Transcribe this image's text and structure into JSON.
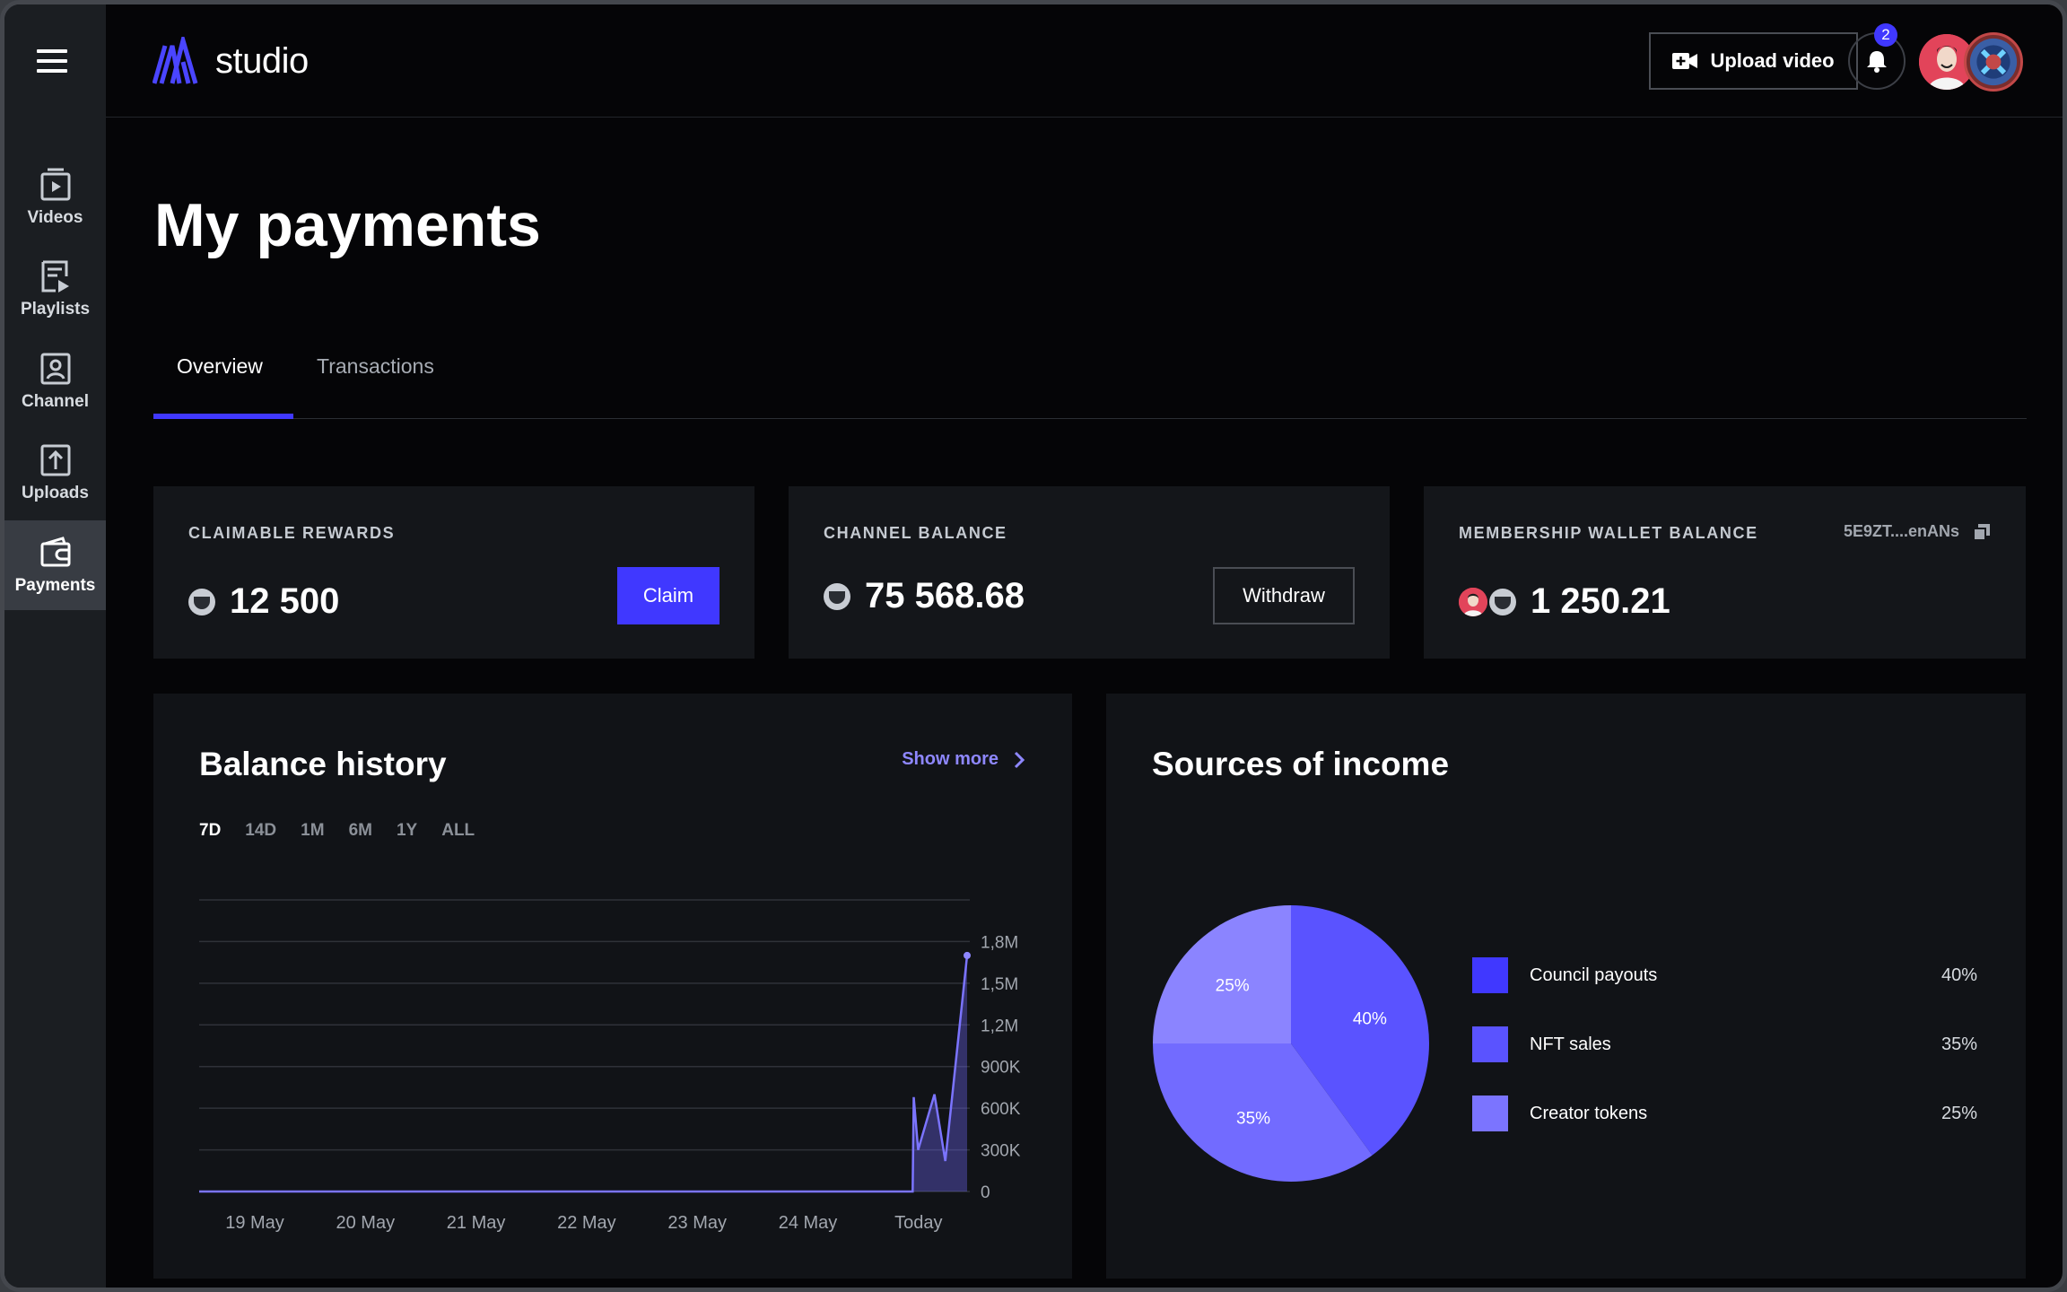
{
  "app": {
    "brand": "studio"
  },
  "sidebar": {
    "items": [
      {
        "label": "Videos",
        "icon": "video-icon"
      },
      {
        "label": "Playlists",
        "icon": "playlist-icon"
      },
      {
        "label": "Channel",
        "icon": "channel-icon"
      },
      {
        "label": "Uploads",
        "icon": "upload-icon"
      },
      {
        "label": "Payments",
        "icon": "wallet-icon",
        "active": true
      }
    ]
  },
  "header": {
    "upload_label": "Upload video",
    "notification_count": "2"
  },
  "page": {
    "title": "My payments",
    "tabs": [
      {
        "label": "Overview",
        "active": true
      },
      {
        "label": "Transactions",
        "active": false
      }
    ]
  },
  "cards": {
    "claimable": {
      "title": "CLAIMABLE REWARDS",
      "amount": "12 500",
      "button": "Claim"
    },
    "channel": {
      "title": "CHANNEL BALANCE",
      "amount": "75 568.68",
      "button": "Withdraw"
    },
    "membership": {
      "title": "MEMBERSHIP WALLET BALANCE",
      "address": "5E9ZT....enANs",
      "amount": "1 250.21"
    }
  },
  "balance_history": {
    "title": "Balance history",
    "show_more": "Show more",
    "ranges": [
      "7D",
      "14D",
      "1M",
      "6M",
      "1Y",
      "ALL"
    ],
    "active_range": "7D"
  },
  "income": {
    "title": "Sources of income",
    "items": [
      {
        "name": "Council payouts",
        "percent": "40%",
        "color": "#4038ff"
      },
      {
        "name": "NFT sales",
        "percent": "35%",
        "color": "#5a53ff"
      },
      {
        "name": "Creator tokens",
        "percent": "25%",
        "color": "#7b74ff"
      }
    ]
  },
  "colors": {
    "accent": "#4038ff",
    "accent_light": "#8e87ff",
    "pie1": "#5a53ff",
    "pie2": "#726bff",
    "pie3": "#8b84ff"
  },
  "chart_data": [
    {
      "type": "area",
      "title": "Balance history",
      "x": [
        "19 May",
        "20 May",
        "21 May",
        "22 May",
        "23 May",
        "24 May",
        "Today"
      ],
      "y_ticks": [
        "0",
        "300K",
        "600K",
        "900K",
        "1,2M",
        "1,5M",
        "1,8M"
      ],
      "ylim": [
        0,
        2100000
      ],
      "points": [
        {
          "x": 0,
          "y": 0
        },
        {
          "x": 6.55,
          "y": 0
        },
        {
          "x": 6.56,
          "y": 680000
        },
        {
          "x": 6.6,
          "y": 300000
        },
        {
          "x": 6.75,
          "y": 700000
        },
        {
          "x": 6.85,
          "y": 220000
        },
        {
          "x": 7.05,
          "y": 1700000
        }
      ],
      "grid": true
    },
    {
      "type": "pie",
      "title": "Sources of income",
      "categories": [
        "Council payouts",
        "NFT sales",
        "Creator tokens"
      ],
      "values": [
        40,
        35,
        25
      ]
    }
  ]
}
